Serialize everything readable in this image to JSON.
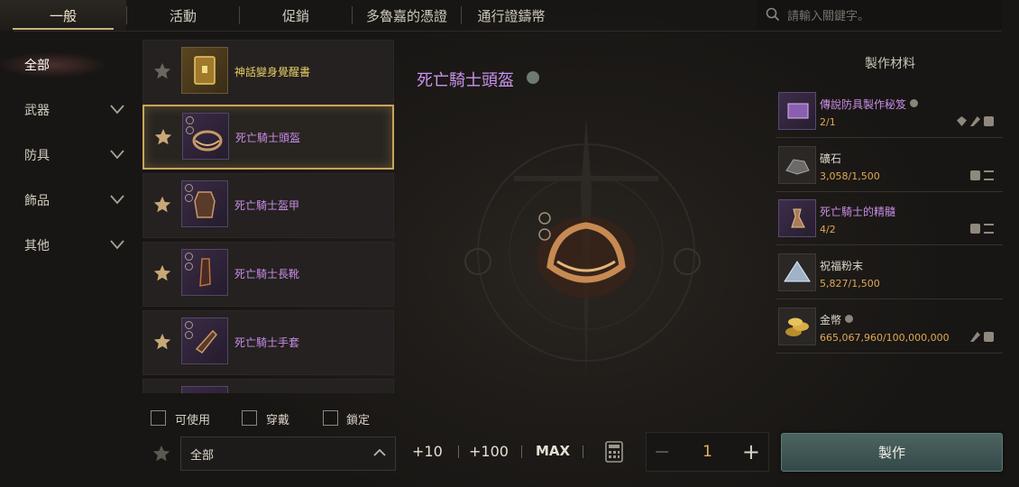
{
  "tabs": [
    {
      "label": "一般",
      "active": true
    },
    {
      "label": "活動",
      "active": false
    },
    {
      "label": "促銷",
      "active": false
    },
    {
      "label": "多魯嘉的憑證",
      "active": false
    },
    {
      "label": "通行證鑄幣",
      "active": false
    }
  ],
  "search": {
    "placeholder": "請輸入關鍵字。",
    "icon": "search-icon"
  },
  "categories": [
    {
      "label": "全部",
      "active": true
    },
    {
      "label": "武器",
      "expandable": true
    },
    {
      "label": "防具",
      "expandable": true
    },
    {
      "label": "飾品",
      "expandable": true
    },
    {
      "label": "其他",
      "expandable": true
    }
  ],
  "items": [
    {
      "name": "神話變身覺醒書",
      "favorite": false,
      "selected": false
    },
    {
      "name": "死亡騎士頭盔",
      "favorite": true,
      "selected": true
    },
    {
      "name": "死亡騎士盔甲",
      "favorite": true,
      "selected": false
    },
    {
      "name": "死亡騎士長靴",
      "favorite": true,
      "selected": false
    },
    {
      "name": "死亡騎士手套",
      "favorite": true,
      "selected": false
    }
  ],
  "filters": {
    "usable": "可使用",
    "equipped": "穿戴",
    "locked": "鎖定"
  },
  "grade_select": {
    "value": "全部"
  },
  "quantity": {
    "plus10": "+10",
    "plus100": "+100",
    "max": "MAX",
    "value": "1",
    "minus": "−",
    "plus": "+"
  },
  "craft_button": "製作",
  "detail": {
    "title": "死亡騎士頭盔"
  },
  "materials": {
    "title": "製作材料",
    "list": [
      {
        "name": "傳說防具製作秘笈",
        "count": "2/1",
        "color": "purple"
      },
      {
        "name": "礦石",
        "count": "3,058/1,500",
        "color": "white"
      },
      {
        "name": "死亡騎士的精髓",
        "count": "4/2",
        "color": "purple"
      },
      {
        "name": "祝福粉末",
        "count": "5,827/1,500",
        "color": "white"
      },
      {
        "name": "金幣",
        "count": "665,067,960/100,000,000",
        "color": "white"
      }
    ]
  },
  "colors": {
    "accent_gold": "#c9a45a",
    "item_purple": "#c98de6",
    "count_orange": "#e0a855",
    "craft_teal": "#4c6461"
  }
}
